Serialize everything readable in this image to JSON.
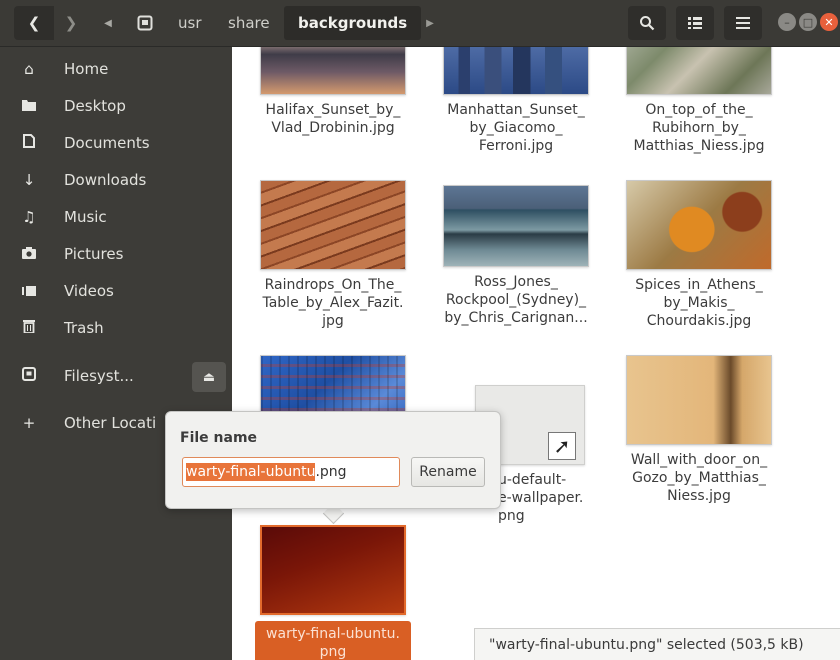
{
  "header": {
    "back_icon": "chevron-left-icon",
    "forward_icon": "chevron-right-icon",
    "breadcrumb": [
      "usr",
      "share",
      "backgrounds"
    ],
    "active_crumb": "backgrounds"
  },
  "sidebar": {
    "items": [
      {
        "label": "Home",
        "icon": "home-icon"
      },
      {
        "label": "Desktop",
        "icon": "folder-icon"
      },
      {
        "label": "Documents",
        "icon": "document-icon"
      },
      {
        "label": "Downloads",
        "icon": "download-icon"
      },
      {
        "label": "Music",
        "icon": "music-icon"
      },
      {
        "label": "Pictures",
        "icon": "camera-icon"
      },
      {
        "label": "Videos",
        "icon": "video-icon"
      },
      {
        "label": "Trash",
        "icon": "trash-icon"
      },
      {
        "label": "Filesyst...",
        "icon": "disk-icon"
      },
      {
        "label": "Other Locati",
        "icon": "plus-icon"
      }
    ]
  },
  "files": [
    {
      "name": "Halifax_Sunset_by_\nVlad_Drobinin.jpg"
    },
    {
      "name": "Manhattan_Sunset_\nby_Giacomo_\nFerroni.jpg"
    },
    {
      "name": "On_top_of_the_\nRubihorn_by_\nMatthias_Niess.jpg"
    },
    {
      "name": "Raindrops_On_The_\nTable_by_Alex_Fazit.\njpg"
    },
    {
      "name": "Ross_Jones_\nRockpool_(Sydney)_\nby_Chris_Carignan..."
    },
    {
      "name": "Spices_in_Athens_\nby_Makis_\nChourdakis.jpg"
    },
    {
      "name": "u-default-\ne-wallpaper.\npng"
    },
    {
      "name": "Wall_with_door_on_\nGozo_by_Matthias_\nNiess.jpg"
    },
    {
      "name": "warty-final-ubuntu.\npng"
    }
  ],
  "rename": {
    "label": "File name",
    "selected_part": "warty-final-ubuntu",
    "extension": ".png",
    "button_label": "Rename"
  },
  "status": {
    "text": "\"warty-final-ubuntu.png\" selected  (503,5 kB)"
  }
}
